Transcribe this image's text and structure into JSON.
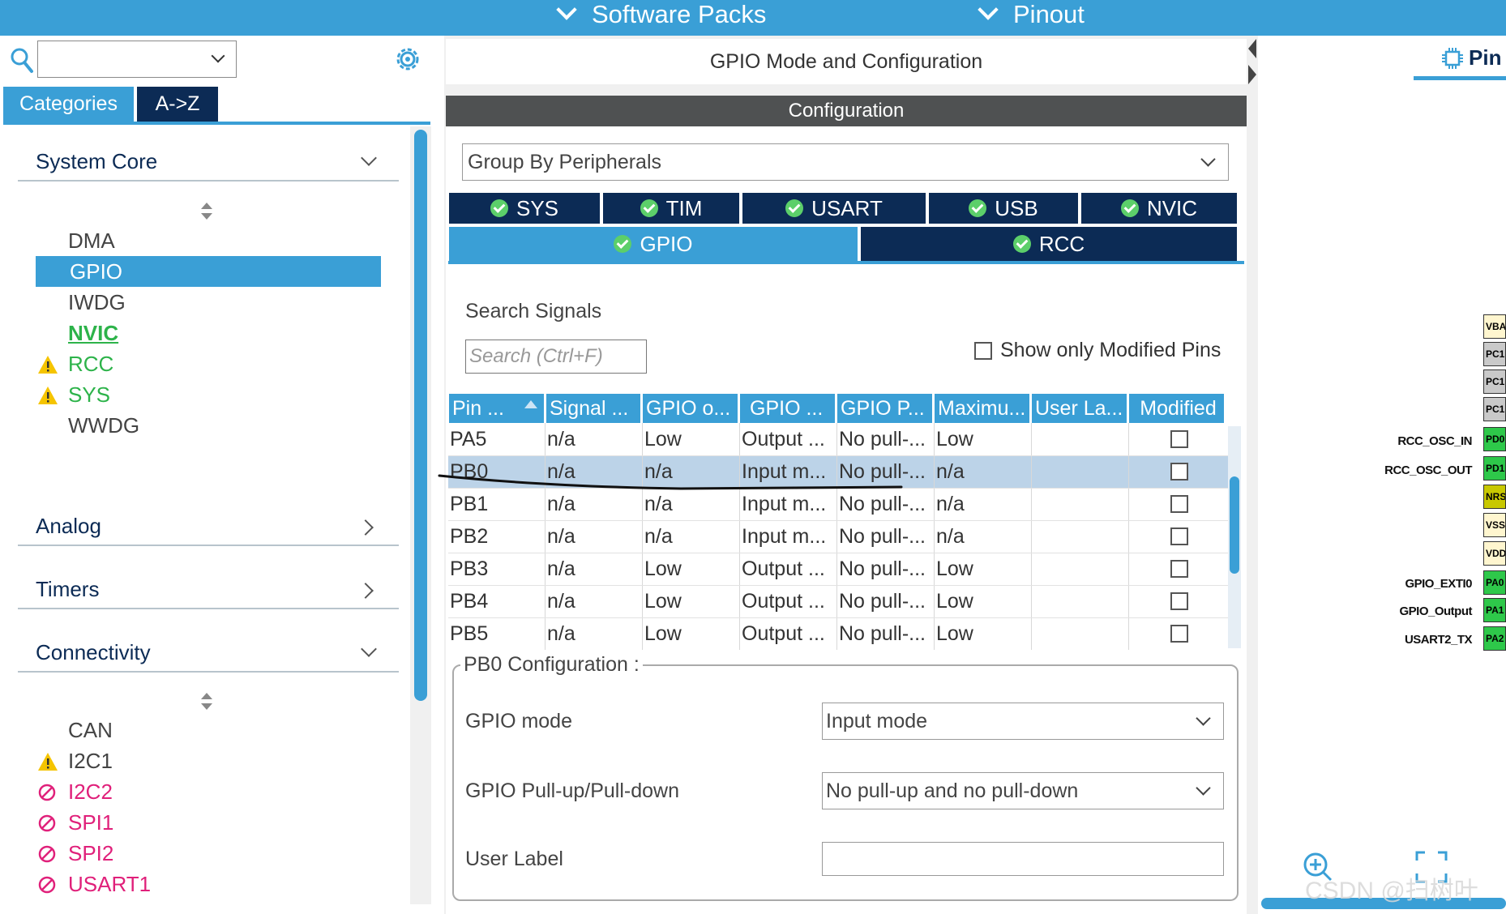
{
  "top_menu": {
    "software_packs": "Software Packs",
    "pinout": "Pinout"
  },
  "left": {
    "tabs": {
      "categories": "Categories",
      "az": "A->Z"
    },
    "system_core": {
      "header": "System Core",
      "items": [
        {
          "label": "DMA",
          "state": "normal"
        },
        {
          "label": "GPIO",
          "state": "selected"
        },
        {
          "label": "IWDG",
          "state": "normal"
        },
        {
          "label": "NVIC",
          "state": "configured"
        },
        {
          "label": "RCC",
          "state": "warning"
        },
        {
          "label": "SYS",
          "state": "warning"
        },
        {
          "label": "WWDG",
          "state": "normal"
        }
      ]
    },
    "analog": "Analog",
    "timers": "Timers",
    "connectivity": {
      "header": "Connectivity",
      "items": [
        {
          "label": "CAN",
          "state": "normal"
        },
        {
          "label": "I2C1",
          "state": "warning"
        },
        {
          "label": "I2C2",
          "state": "disabled"
        },
        {
          "label": "SPI1",
          "state": "disabled"
        },
        {
          "label": "SPI2",
          "state": "disabled"
        },
        {
          "label": "USART1",
          "state": "disabled"
        }
      ]
    }
  },
  "center": {
    "title": "GPIO Mode and Configuration",
    "configuration": "Configuration",
    "group_by": "Group By Peripherals",
    "peripheral_tabs_row1": [
      "SYS",
      "TIM",
      "USART",
      "USB",
      "NVIC"
    ],
    "peripheral_tabs_row2": [
      "GPIO",
      "RCC"
    ],
    "active_tab": "GPIO",
    "search_signals_label": "Search Signals",
    "search_placeholder": "Search (Ctrl+F)",
    "show_modified": "Show only Modified Pins",
    "table": {
      "columns": [
        "Pin ...",
        "Signal ...",
        "GPIO o...",
        "GPIO ...",
        "GPIO P...",
        "Maximu...",
        "User La...",
        "Modified"
      ],
      "rows": [
        [
          "PA5",
          "n/a",
          "Low",
          "Output ...",
          "No pull-...",
          "Low",
          "",
          ""
        ],
        [
          "PB0",
          "n/a",
          "n/a",
          "Input m...",
          "No pull-...",
          "n/a",
          "",
          ""
        ],
        [
          "PB1",
          "n/a",
          "n/a",
          "Input m...",
          "No pull-...",
          "n/a",
          "",
          ""
        ],
        [
          "PB2",
          "n/a",
          "n/a",
          "Input m...",
          "No pull-...",
          "n/a",
          "",
          ""
        ],
        [
          "PB3",
          "n/a",
          "Low",
          "Output ...",
          "No pull-...",
          "Low",
          "",
          ""
        ],
        [
          "PB4",
          "n/a",
          "Low",
          "Output ...",
          "No pull-...",
          "Low",
          "",
          ""
        ],
        [
          "PB5",
          "n/a",
          "Low",
          "Output ...",
          "No pull-...",
          "Low",
          "",
          ""
        ]
      ],
      "selected_row": 1
    },
    "pb0_config": {
      "title": "PB0 Configuration :",
      "gpio_mode_label": "GPIO mode",
      "gpio_mode_value": "Input mode",
      "pull_label": "GPIO Pull-up/Pull-down",
      "pull_value": "No pull-up and no pull-down",
      "user_label_label": "User Label",
      "user_label_value": ""
    }
  },
  "right": {
    "tab": "Pin",
    "pins": [
      {
        "text": "VBA",
        "color": "cream",
        "label": ""
      },
      {
        "text": "PC1",
        "color": "gray",
        "label": ""
      },
      {
        "text": "PC1",
        "color": "gray",
        "label": ""
      },
      {
        "text": "PC1",
        "color": "gray",
        "label": ""
      },
      {
        "text": "PD0",
        "color": "green",
        "label": "RCC_OSC_IN"
      },
      {
        "text": "PD1",
        "color": "green",
        "label": "RCC_OSC_OUT"
      },
      {
        "text": "NRS",
        "color": "olive",
        "label": ""
      },
      {
        "text": "VSS",
        "color": "cream",
        "label": ""
      },
      {
        "text": "VDD",
        "color": "cream",
        "label": ""
      },
      {
        "text": "PA0",
        "color": "green",
        "label": "GPIO_EXTI0"
      },
      {
        "text": "PA1",
        "color": "green",
        "label": "GPIO_Output"
      },
      {
        "text": "PA2",
        "color": "green",
        "label": "USART2_TX"
      }
    ]
  },
  "watermark": "CSDN @扫树叶",
  "colors": {
    "accent": "#3a9fd6",
    "navy": "#0c2b55",
    "ok_green": "#5ccf6a",
    "warning": "#f5c400",
    "disabled": "#e0207a"
  }
}
